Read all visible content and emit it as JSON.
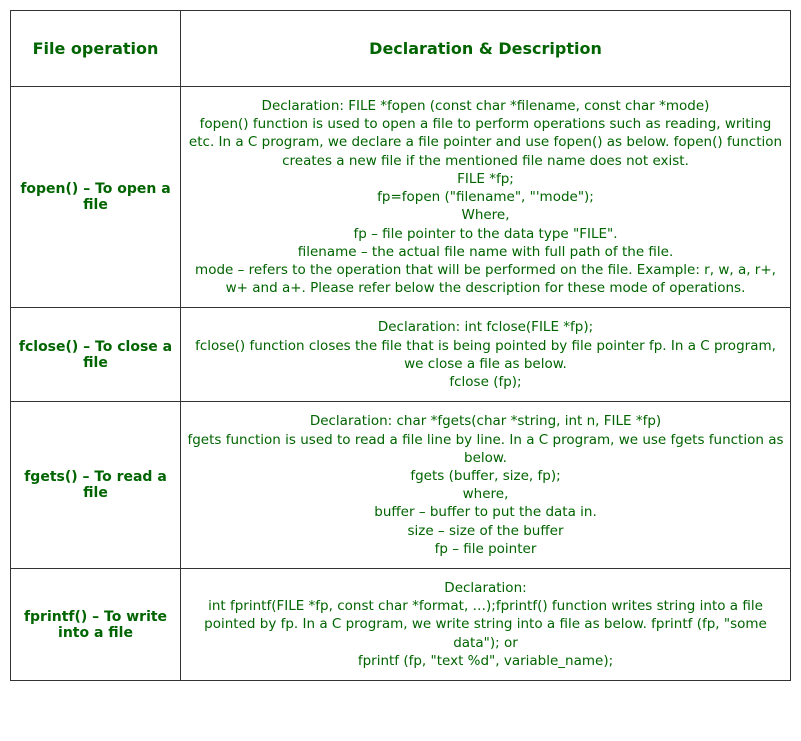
{
  "headers": {
    "col1": "File operation",
    "col2": "Declaration & Description"
  },
  "rows": [
    {
      "operation": "fopen() – To open a file",
      "lines": [
        "Declaration: FILE *fopen (const char *filename, const char *mode)",
        "fopen() function is used to open a file to perform operations such as reading, writing etc. In a C program, we declare a file pointer and use fopen() as below. fopen() function creates a new file if the mentioned file name does not exist.",
        "FILE *fp;",
        "fp=fopen (\"filename\", \"'mode\");",
        "Where,",
        "fp – file pointer to the data type \"FILE\".",
        "filename – the actual file name with full path of the file.",
        "mode – refers to the operation that will be performed on the file. Example: r, w, a, r+, w+ and a+. Please refer below the description for these mode of operations."
      ]
    },
    {
      "operation": "fclose() – To close a file",
      "lines": [
        "Declaration: int fclose(FILE *fp);",
        "fclose() function closes the file that is being pointed by file pointer fp. In a C program, we close a file as below.",
        "fclose (fp);"
      ]
    },
    {
      "operation": "fgets() – To read a file",
      "lines": [
        "Declaration: char *fgets(char *string, int n, FILE *fp)",
        "fgets function is used to read a file line by line. In a C program, we use fgets function as below.",
        "fgets (buffer, size, fp);",
        "where,",
        "buffer – buffer to put the data in.",
        "size – size of the buffer",
        "fp – file pointer"
      ]
    },
    {
      "operation": "fprintf() – To write into a file",
      "lines": [
        "Declaration:",
        "int fprintf(FILE *fp, const char *format, …);fprintf() function writes string into a file pointed by fp. In a C program, we write string into a file as below. fprintf (fp, \"some data\"); or",
        "fprintf (fp, \"text %d\", variable_name);"
      ]
    }
  ]
}
